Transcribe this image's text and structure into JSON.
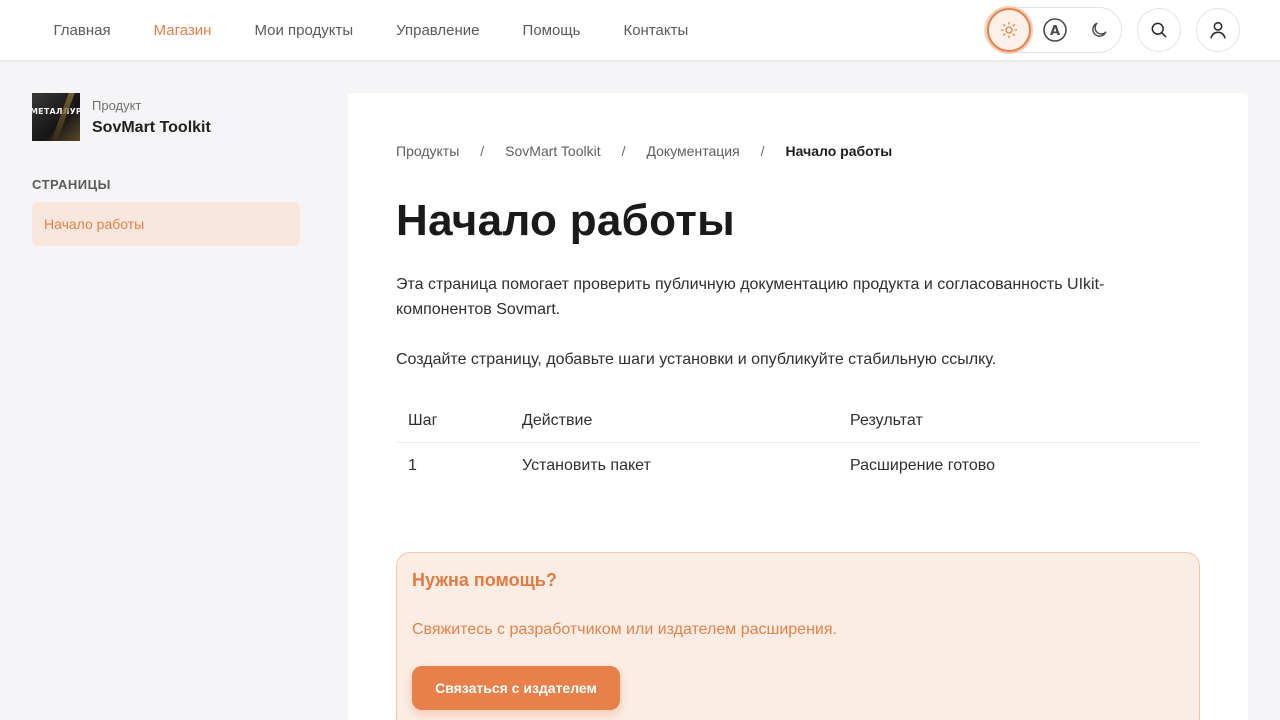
{
  "nav": {
    "items": [
      {
        "label": "Главная",
        "active": false
      },
      {
        "label": "Магазин",
        "active": true
      },
      {
        "label": "Мои продукты",
        "active": false
      },
      {
        "label": "Управление",
        "active": false
      },
      {
        "label": "Помощь",
        "active": false
      },
      {
        "label": "Контакты",
        "active": false
      }
    ],
    "theme_auto_glyph": "A",
    "icons": [
      "sun-icon",
      "auto-theme-icon",
      "moon-icon",
      "search-icon",
      "user-icon"
    ]
  },
  "sidebar": {
    "product_label": "Продукт",
    "product_name": "SovMart Toolkit",
    "thumb_text": "МЕТАЛЛУРГА!",
    "section_title": "СТРАНИЦЫ",
    "pages": [
      {
        "label": "Начало работы",
        "active": true
      }
    ]
  },
  "main": {
    "breadcrumb": [
      "Продукты",
      "SovMart Toolkit",
      "Документация",
      "Начало работы"
    ],
    "breadcrumb_sep": "/",
    "title": "Начало работы",
    "paragraph1": "Эта страница помогает проверить публичную документацию продукта и согласованность UIkit-компонентов Sovmart.",
    "paragraph2": "Создайте страницу, добавьте шаги установки и опубликуйте стабильную ссылку.",
    "table": {
      "headers": [
        "Шаг",
        "Действие",
        "Результат"
      ],
      "rows": [
        [
          "1",
          "Установить пакет",
          "Расширение готово"
        ]
      ]
    },
    "help": {
      "title": "Нужна помощь?",
      "text": "Свяжитесь с разработчиком или издателем расширения.",
      "button": "Связаться с издателем"
    }
  },
  "colors": {
    "accent": "#e4824a",
    "accent_soft": "#f9e6dc",
    "help_bg": "#fcede4"
  }
}
